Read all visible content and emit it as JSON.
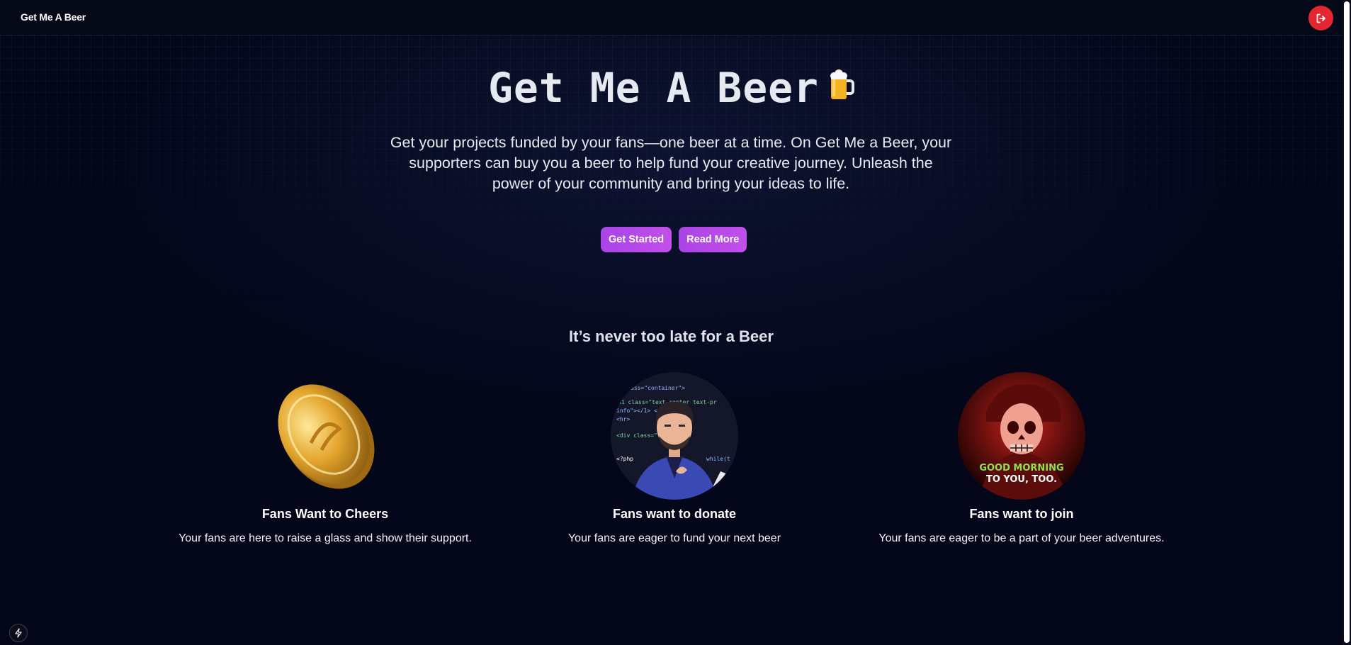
{
  "navbar": {
    "brand": "Get Me A Beer",
    "logout_icon": "logout-icon"
  },
  "hero": {
    "title": "Get Me A Beer",
    "title_icon": "beer-mug-icon",
    "description": "Get your projects funded by your fans—one beer at a time. On Get Me a Beer, your supporters can buy you a beer to help fund your creative journey. Unleash the power of your community and bring your ideas to life.",
    "buttons": {
      "get_started": "Get Started",
      "read_more": "Read More"
    }
  },
  "section": {
    "title": "It’s never too late for a Beer"
  },
  "features": [
    {
      "image": "gold-coin-image",
      "title": "Fans Want to Cheers",
      "text": "Your fans are here to raise a glass and show their support."
    },
    {
      "image": "developer-avatar-image",
      "title": "Fans want to donate",
      "text": "Your fans are eager to fund your next beer"
    },
    {
      "image": "skull-soldier-image",
      "title": "Fans want to join",
      "text": "Your fans are eager to be a part of your beer adventures.",
      "image_caption": {
        "line1": "GOOD MORNING",
        "line2": "TO YOU, TOO."
      }
    }
  ],
  "code_snippet": {
    "l1": "ass=\"container\">",
    "l2": "h1 class=\"text-center text-pr",
    "l3": "info\"></1>  </h",
    "l4": "<hr>",
    "l5": "<div class=\"",
    "l6": "<?php",
    "l7": "while(t"
  },
  "colors": {
    "background": "#04071a",
    "accent_purple": "#b54ae8",
    "logout_red": "#e3262f"
  }
}
